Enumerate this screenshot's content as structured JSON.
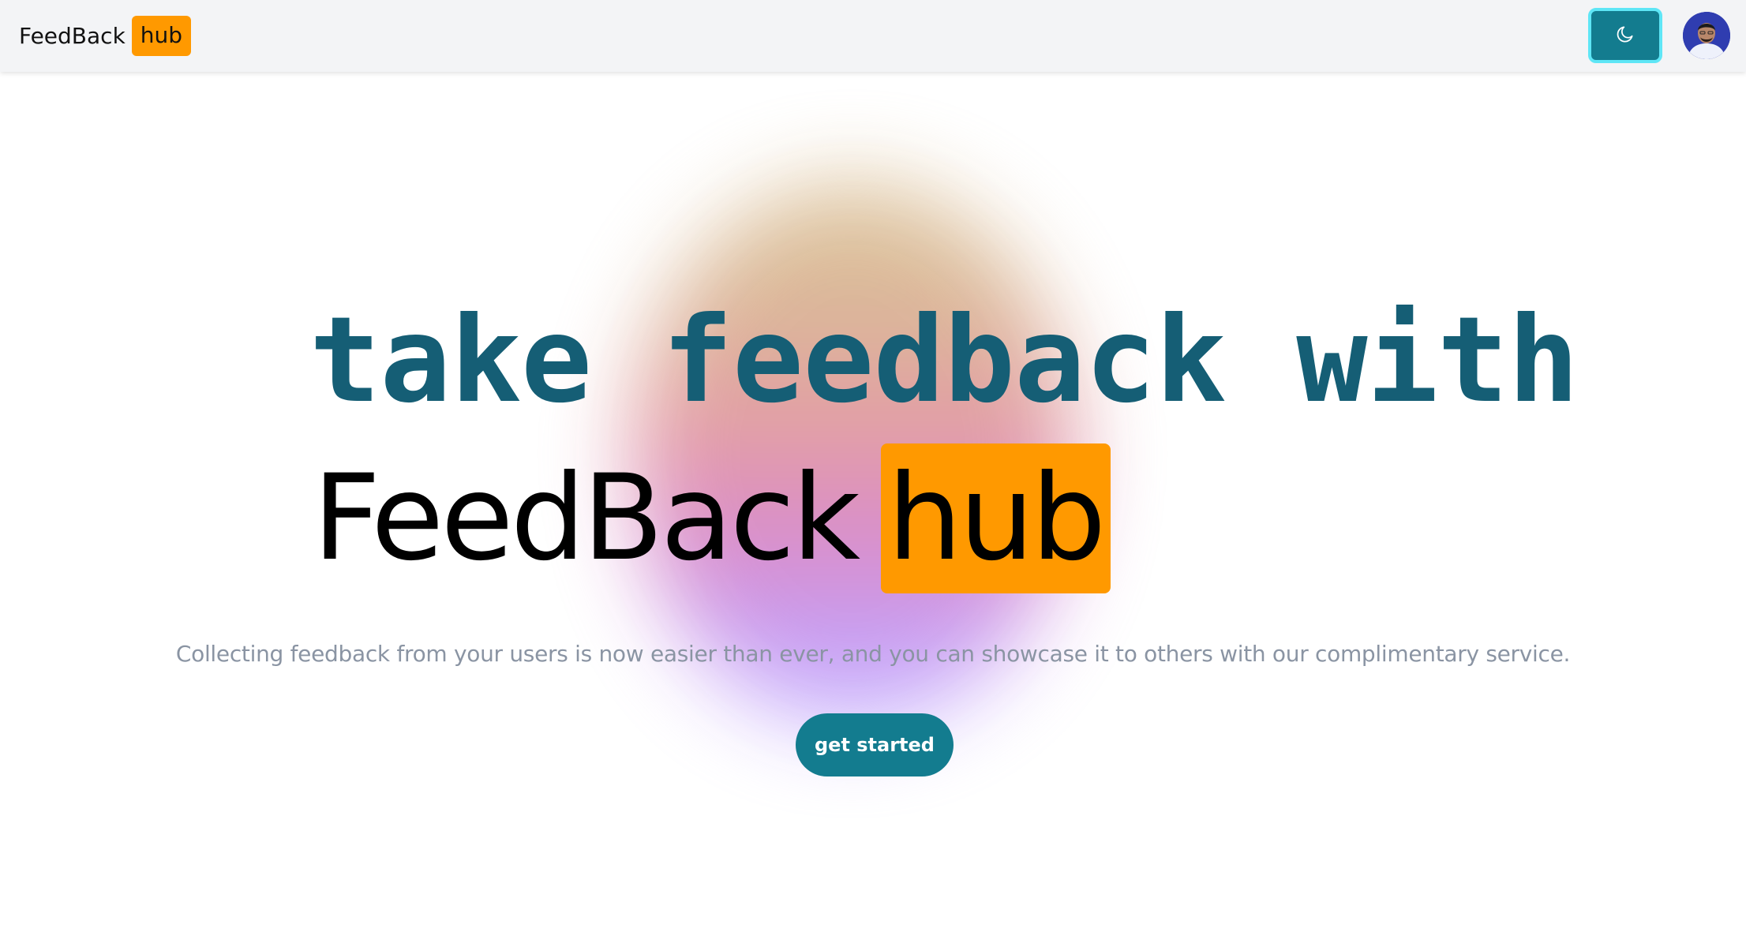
{
  "nav": {
    "brand_main": "FeedBack",
    "brand_badge": "hub",
    "theme_toggle_icon": "moon-icon",
    "avatar_icon": "user-avatar"
  },
  "hero": {
    "headline_line1": "take feedback with",
    "headline_brand_main": "FeedBack",
    "headline_brand_badge": "hub",
    "tagline": "Collecting feedback from your users is now easier than ever, and you can showcase it to others with our complimentary service.",
    "cta_label": "get started"
  },
  "colors": {
    "accent": "#137c8f",
    "badge": "#ff9900",
    "headline": "#155e75",
    "navbar_bg": "#f3f4f6",
    "tagline": "#8a94a3"
  }
}
